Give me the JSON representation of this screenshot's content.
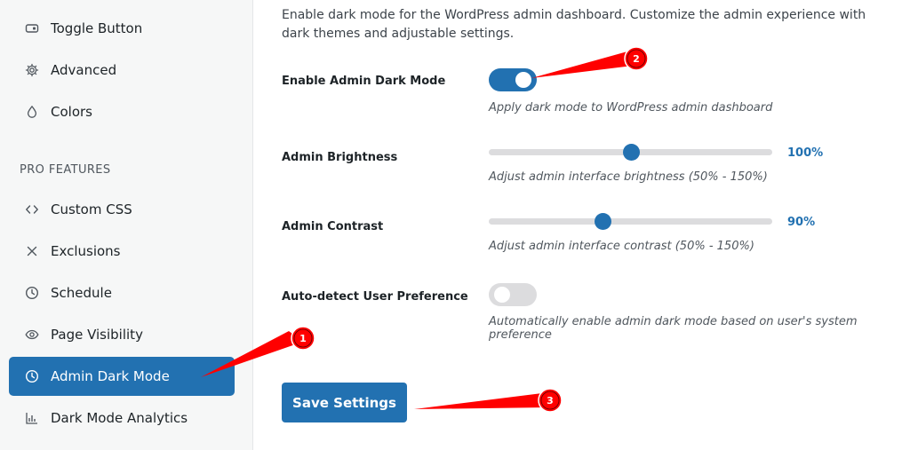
{
  "sidebar": {
    "items": [
      {
        "label": "Toggle Button",
        "icon": "toggle-icon"
      },
      {
        "label": "Advanced",
        "icon": "gear-icon"
      },
      {
        "label": "Colors",
        "icon": "droplet-icon"
      }
    ],
    "pro_section_label": "PRO FEATURES",
    "pro_items": [
      {
        "label": "Custom CSS",
        "icon": "code-icon"
      },
      {
        "label": "Exclusions",
        "icon": "x-icon"
      },
      {
        "label": "Schedule",
        "icon": "clock-icon"
      },
      {
        "label": "Page Visibility",
        "icon": "eye-icon"
      },
      {
        "label": "Admin Dark Mode",
        "icon": "clock-icon",
        "active": true
      },
      {
        "label": "Dark Mode Analytics",
        "icon": "bar-chart-icon"
      }
    ]
  },
  "main": {
    "description": "Enable dark mode for the WordPress admin dashboard. Customize the admin experience with dark themes and adjustable settings.",
    "settings": {
      "enable": {
        "label": "Enable Admin Dark Mode",
        "help": "Apply dark mode to WordPress admin dashboard",
        "on": true
      },
      "brightness": {
        "label": "Admin Brightness",
        "value_text": "100%",
        "value": 100,
        "min": 50,
        "max": 150,
        "help": "Adjust admin interface brightness (50% - 150%)"
      },
      "contrast": {
        "label": "Admin Contrast",
        "value_text": "90%",
        "value": 90,
        "min": 50,
        "max": 150,
        "help": "Adjust admin interface contrast (50% - 150%)"
      },
      "autodetect": {
        "label": "Auto-detect User Preference",
        "help": "Automatically enable admin dark mode based on user's system preference",
        "on": false
      }
    },
    "save_label": "Save Settings"
  },
  "annotations": {
    "badges": [
      "1",
      "2",
      "3"
    ],
    "color": "#ff0000"
  },
  "colors": {
    "accent": "#2271b1",
    "sidebar_bg": "#f6f7f7",
    "toggle_off": "#dcdcde"
  }
}
